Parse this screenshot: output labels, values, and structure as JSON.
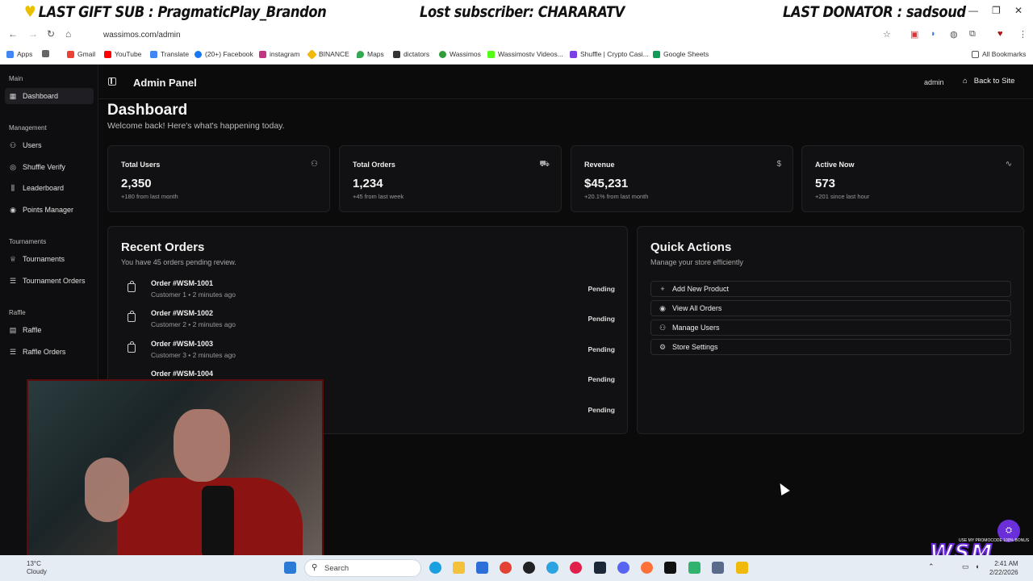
{
  "overlay": {
    "gift_sub": "LAST GIFT SUB : PragmaticPlay_Brandon",
    "subscriber": "Lost subscriber: CHARARATV",
    "donator": "LAST DONATOR : sadsoud"
  },
  "browser": {
    "url": "wassimos.com/admin",
    "bookmarks": [
      {
        "label": "Apps",
        "color": "#4285f4"
      },
      {
        "label": "Gmail",
        "color": "#ea4335"
      },
      {
        "label": "YouTube",
        "color": "#ff0000"
      },
      {
        "label": "Translate",
        "color": "#4285f4"
      },
      {
        "label": "(20+) Facebook",
        "color": "#1877f2"
      },
      {
        "label": "instagram",
        "color": "#c13584"
      },
      {
        "label": "BINANCE",
        "color": "#f0b90b"
      },
      {
        "label": "Maps",
        "color": "#34a853"
      },
      {
        "label": "dictators",
        "color": "#333333"
      },
      {
        "label": "Wassimos",
        "color": "#2e9d3a"
      },
      {
        "label": "Wassimostv Videos...",
        "color": "#53fc18"
      },
      {
        "label": "Shuffle | Crypto Casi...",
        "color": "#7b3fe4"
      },
      {
        "label": "Google Sheets",
        "color": "#0f9d58"
      }
    ],
    "all_bookmarks": "All Bookmarks"
  },
  "sidebar": {
    "sections": [
      {
        "title": "Main",
        "items": [
          {
            "label": "Dashboard",
            "icon": "grid-icon",
            "active": true
          }
        ]
      },
      {
        "title": "Management",
        "items": [
          {
            "label": "Users",
            "icon": "users-icon"
          },
          {
            "label": "Shuffle Verify",
            "icon": "check-circle-icon"
          },
          {
            "label": "Leaderboard",
            "icon": "bar-chart-icon"
          },
          {
            "label": "Points Manager",
            "icon": "coins-icon"
          }
        ]
      },
      {
        "title": "Tournaments",
        "items": [
          {
            "label": "Tournaments",
            "icon": "trophy-icon"
          },
          {
            "label": "Tournament Orders",
            "icon": "list-icon"
          }
        ]
      },
      {
        "title": "Raffle",
        "items": [
          {
            "label": "Raffle",
            "icon": "ticket-icon"
          },
          {
            "label": "Raffle Orders",
            "icon": "list-icon"
          }
        ]
      }
    ]
  },
  "header": {
    "title": "Admin Panel",
    "role": "admin",
    "back_label": "Back to Site"
  },
  "page": {
    "title": "Dashboard",
    "subtitle": "Welcome back! Here's what's happening today."
  },
  "stats": [
    {
      "label": "Total Users",
      "value": "2,350",
      "sub": "+180 from last month",
      "icon": "users-icon"
    },
    {
      "label": "Total Orders",
      "value": "1,234",
      "sub": "+45 from last week",
      "icon": "cart-icon"
    },
    {
      "label": "Revenue",
      "value": "$45,231",
      "sub": "+20.1% from last month",
      "icon": "dollar-icon"
    },
    {
      "label": "Active Now",
      "value": "573",
      "sub": "+201 since last hour",
      "icon": "activity-icon"
    }
  ],
  "recent_orders": {
    "title": "Recent Orders",
    "subtitle": "You have 45 orders pending review.",
    "orders": [
      {
        "name": "Order #WSM-1001",
        "meta": "Customer 1 • 2 minutes ago",
        "status": "Pending"
      },
      {
        "name": "Order #WSM-1002",
        "meta": "Customer 2 • 2 minutes ago",
        "status": "Pending"
      },
      {
        "name": "Order #WSM-1003",
        "meta": "Customer 3 • 2 minutes ago",
        "status": "Pending"
      },
      {
        "name": "Order #WSM-1004",
        "meta": "",
        "status": "Pending"
      },
      {
        "name": "",
        "meta": "",
        "status": "Pending"
      }
    ]
  },
  "quick_actions": {
    "title": "Quick Actions",
    "subtitle": "Manage your store efficiently",
    "actions": [
      {
        "label": "Add New Product",
        "icon": "plus-icon"
      },
      {
        "label": "View All Orders",
        "icon": "eye-icon"
      },
      {
        "label": "Manage Users",
        "icon": "user-cog-icon"
      },
      {
        "label": "Store Settings",
        "icon": "gear-icon"
      }
    ]
  },
  "taskbar": {
    "weather_temp": "13°C",
    "weather_desc": "Cloudy",
    "search_placeholder": "Search",
    "time": "2:41 AM",
    "date": "2/22/2026"
  },
  "brand": {
    "logo_text": "WSM",
    "promo": "USE MY PROMOCODE 100% BONUS"
  }
}
